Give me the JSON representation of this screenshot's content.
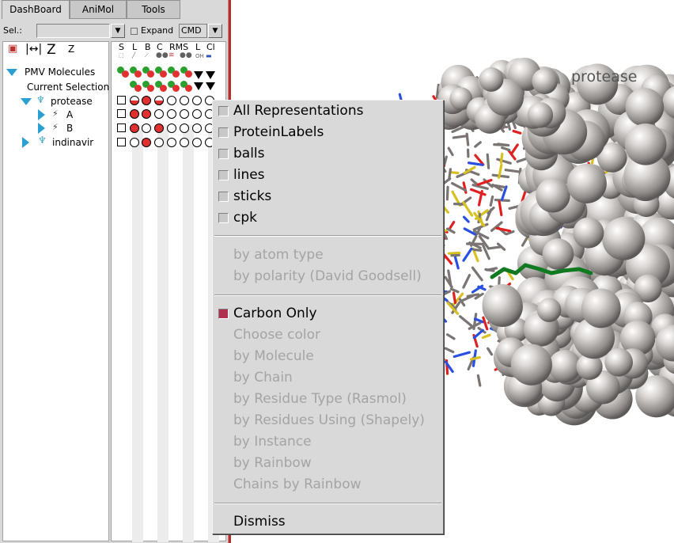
{
  "tabs": [
    "DashBoard",
    "AniMol",
    "Tools"
  ],
  "selection": {
    "label": "Sel.:",
    "value": "",
    "expand_label": "Expand",
    "cmd_value": "CMD"
  },
  "toolbar": {
    "z_label": "Z"
  },
  "columns": [
    "S",
    "L",
    "B",
    "C",
    "RMS",
    "L",
    "Cl"
  ],
  "tree": {
    "root": "PMV Molecules",
    "current_selection": "Current Selection",
    "molecules": [
      {
        "name": "protease",
        "chains": [
          "A",
          "B"
        ]
      },
      {
        "name": "indinavir",
        "chains": []
      }
    ]
  },
  "viewer": {
    "molecule_label": "protease"
  },
  "menu": {
    "items_top": [
      {
        "label": "All Representations",
        "checked": false
      },
      {
        "label": "ProteinLabels",
        "checked": false
      },
      {
        "label": "balls",
        "checked": false
      },
      {
        "label": "lines",
        "checked": false
      },
      {
        "label": "sticks",
        "checked": false
      },
      {
        "label": "cpk",
        "checked": false
      }
    ],
    "color_by": [
      "by atom type",
      "by polarity (David Goodsell)"
    ],
    "carbon_only": {
      "label": "Carbon Only",
      "checked": true
    },
    "color_options": [
      "Choose color",
      "by Molecule",
      "by Chain",
      "by Residue Type (Rasmol)",
      "by Residues Using (Shapely)",
      "by Instance",
      "by Rainbow",
      "Chains by Rainbow"
    ],
    "dismiss": "Dismiss"
  },
  "colors": {
    "checked": "#b03050",
    "disabled_text": "#a4a4a4",
    "divider": "#b03030"
  }
}
